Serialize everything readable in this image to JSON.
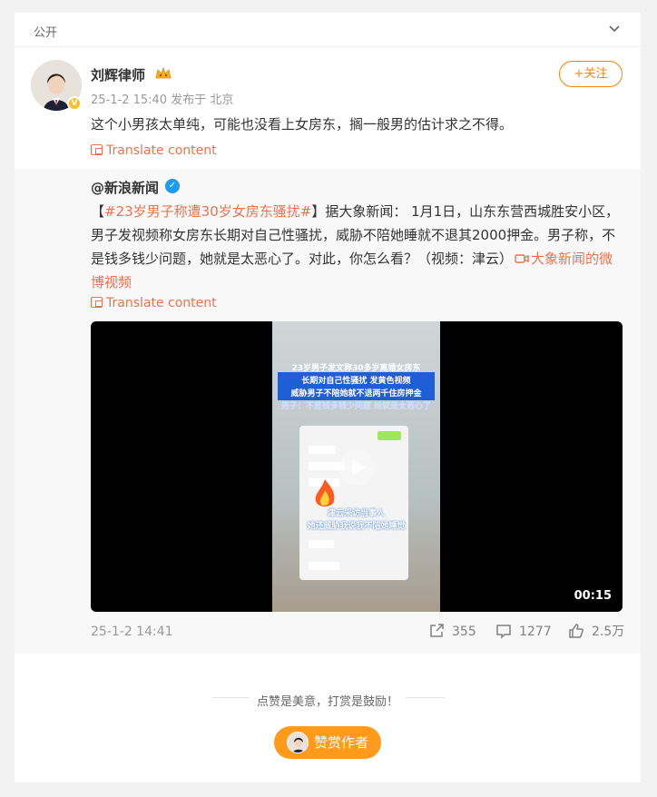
{
  "topbar": {
    "visibility": "公开"
  },
  "post": {
    "author": "刘辉律师",
    "time": "25-1-2 15:40",
    "location": "发布于 北京",
    "follow_label": "+关注",
    "text": "这个小男孩太单纯，可能也没看上女房东，搁一般男的估计求之不得。",
    "translate_label": "Translate content"
  },
  "repost": {
    "author": "@新浪新闻",
    "bracket_open": "【",
    "hashtag": "#23岁男子称遭30岁女房东骚扰#",
    "text_after_hashtag": "】据大象新闻： 1月1日，山东东营西城胜安小区，男子发视频称女房东长期对自己性骚扰，威胁不陪她睡就不退其2000押金。男子称，不是钱多钱少问题，她就是太恶心了。对此，你怎么看？（视频：津云）",
    "video_link": "大象新闻的微博视频",
    "translate_label": "Translate content",
    "video": {
      "duration": "00:15",
      "overlay_line1": "23岁男子发文称30多岁离婚女房东",
      "overlay_line2": "长期对自己性骚扰 发黄色视频",
      "overlay_line3": "威胁男子不陪她就不退两千住房押金",
      "overlay_line4": "男子：不是钱多钱少问题 她就是太恶心了",
      "overlay_line5": "津云采访当事人",
      "overlay_line6": "她还威胁我说我不陪她睡觉"
    },
    "time": "25-1-2 14:41",
    "stats": {
      "reposts": "355",
      "comments": "1277",
      "likes": "2.5万"
    }
  },
  "reward": {
    "slogan": "点赞是美意，打赏是鼓励！",
    "button_label": "赞赏作者"
  }
}
